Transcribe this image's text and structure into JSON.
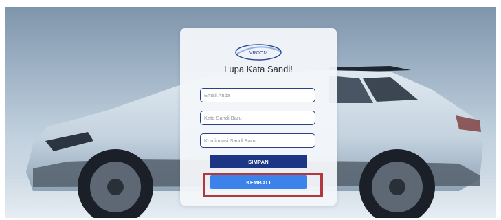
{
  "logo": {
    "text": "VROOM"
  },
  "form": {
    "title": "Lupa Kata Sandi!",
    "email_placeholder": "Email Anda",
    "new_password_placeholder": "Kata Sandi Baru",
    "confirm_password_placeholder": "Konfirmasi Sandi Baru",
    "save_label": "SIMPAN",
    "back_label": "KEMBALI"
  },
  "colors": {
    "primary_button": "#1c3685",
    "secondary_button": "#3b82ea",
    "field_border": "#2d3f8c",
    "highlight": "#b3383e"
  }
}
